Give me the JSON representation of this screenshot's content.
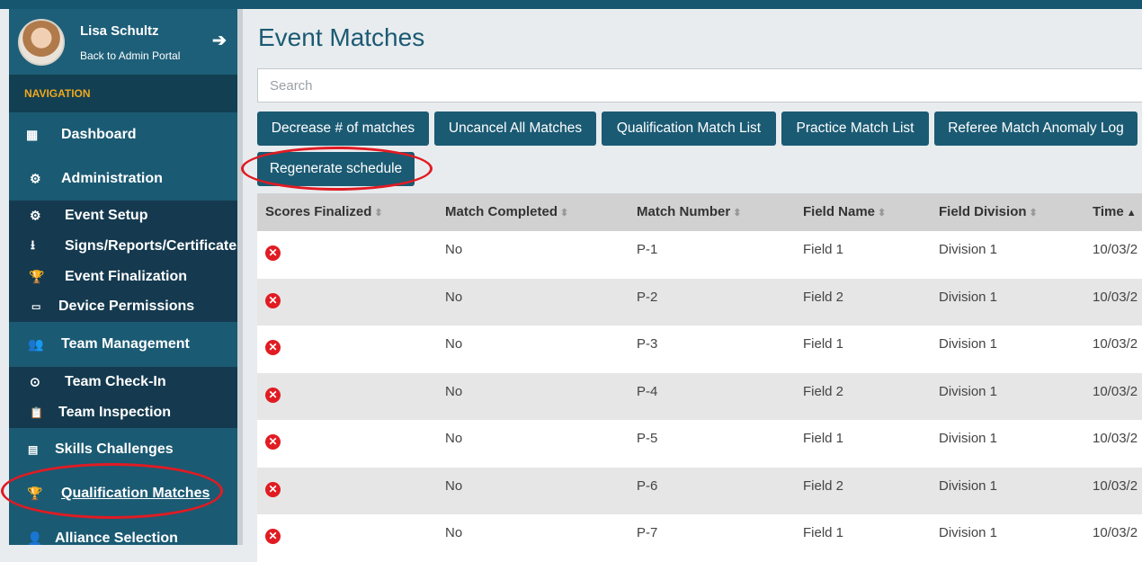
{
  "profile": {
    "name": "Lisa Schultz",
    "link": "Back to Admin Portal",
    "arrow": "➔"
  },
  "nav_header": "NAVIGATION",
  "nav": {
    "dashboard": {
      "icon": "▦",
      "label": "Dashboard"
    },
    "administration": {
      "icon": "⚙",
      "label": "Administration"
    },
    "event_setup": {
      "icon": "⚙",
      "label": "Event Setup"
    },
    "signs": {
      "icon": "⭳",
      "label": "Signs/Reports/Certificates"
    },
    "finalization": {
      "icon": "🏆",
      "label": "Event Finalization"
    },
    "device": {
      "icon": "▭",
      "label": "Device Permissions"
    },
    "team_mgmt": {
      "icon": "👥",
      "label": "Team Management"
    },
    "checkin": {
      "icon": "⊙",
      "label": "Team Check-In"
    },
    "inspection": {
      "icon": "📋",
      "label": "Team Inspection"
    },
    "skills": {
      "icon": "▤",
      "label": "Skills Challenges"
    },
    "qual": {
      "icon": "🏆",
      "label": "Qualification Matches"
    },
    "alliance": {
      "icon": "👤",
      "label": "Alliance Selection"
    }
  },
  "page_title": "Event Matches",
  "search_placeholder": "Search",
  "buttons": {
    "decrease": "Decrease # of matches",
    "uncancel": "Uncancel All Matches",
    "qual_list": "Qualification Match List",
    "practice_list": "Practice Match List",
    "referee_log": "Referee Match Anomaly Log",
    "regenerate": "Regenerate schedule"
  },
  "table": {
    "headers": [
      "Scores Finalized",
      "Match Completed",
      "Match Number",
      "Field Name",
      "Field Division",
      "Time"
    ],
    "sort_icon": "⬍",
    "sort_up_icon": "▲",
    "x_icon": "✕",
    "rows": [
      {
        "completed": "No",
        "number": "P-1",
        "field": "Field 1",
        "division": "Division 1",
        "time": "10/03/2"
      },
      {
        "completed": "No",
        "number": "P-2",
        "field": "Field 2",
        "division": "Division 1",
        "time": "10/03/2"
      },
      {
        "completed": "No",
        "number": "P-3",
        "field": "Field 1",
        "division": "Division 1",
        "time": "10/03/2"
      },
      {
        "completed": "No",
        "number": "P-4",
        "field": "Field 2",
        "division": "Division 1",
        "time": "10/03/2"
      },
      {
        "completed": "No",
        "number": "P-5",
        "field": "Field 1",
        "division": "Division 1",
        "time": "10/03/2"
      },
      {
        "completed": "No",
        "number": "P-6",
        "field": "Field 2",
        "division": "Division 1",
        "time": "10/03/2"
      },
      {
        "completed": "No",
        "number": "P-7",
        "field": "Field 1",
        "division": "Division 1",
        "time": "10/03/2"
      }
    ]
  },
  "colors": {
    "primary": "#1b5a73",
    "nav_header": "#f0a81c",
    "highlight": "#e11b22"
  }
}
